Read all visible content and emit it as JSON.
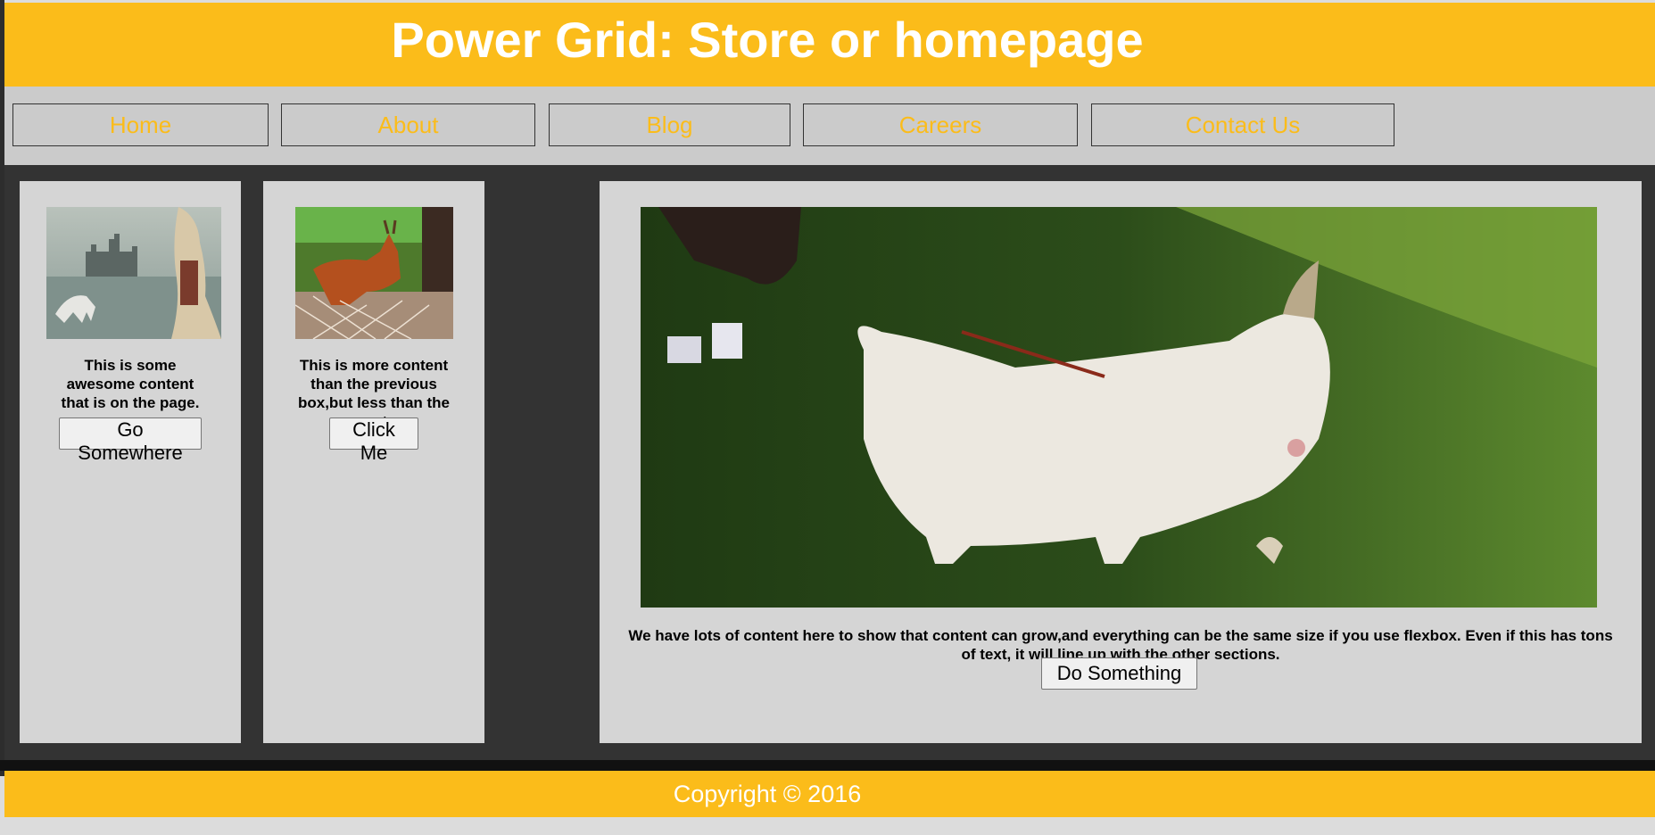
{
  "header": {
    "title": "Power Grid: Store or homepage"
  },
  "nav": {
    "items": [
      {
        "label": "Home"
      },
      {
        "label": "About"
      },
      {
        "label": "Blog"
      },
      {
        "label": "Careers"
      },
      {
        "label": "Contact Us"
      }
    ]
  },
  "cards": [
    {
      "text": "This is some awesome content that is on the page.",
      "button": "Go Somewhere",
      "image": "castle-woman-horse-image"
    },
    {
      "text": "This is more content than the previous box,but less than the next.",
      "button": "Click Me",
      "image": "deer-image"
    },
    {
      "text": "We have lots of content here to show that content can grow,and everything can be the same size if you use flexbox. Even if this has tons of text, it will line up with the other sections.",
      "button": "Do Something",
      "image": "white-goat-image"
    }
  ],
  "footer": {
    "text": "Copyright © 2016"
  },
  "colors": {
    "accent": "#fbbc1a",
    "nav_bg": "#cbcbcb",
    "content_bg": "#333333",
    "card_bg": "#d5d5d5"
  }
}
